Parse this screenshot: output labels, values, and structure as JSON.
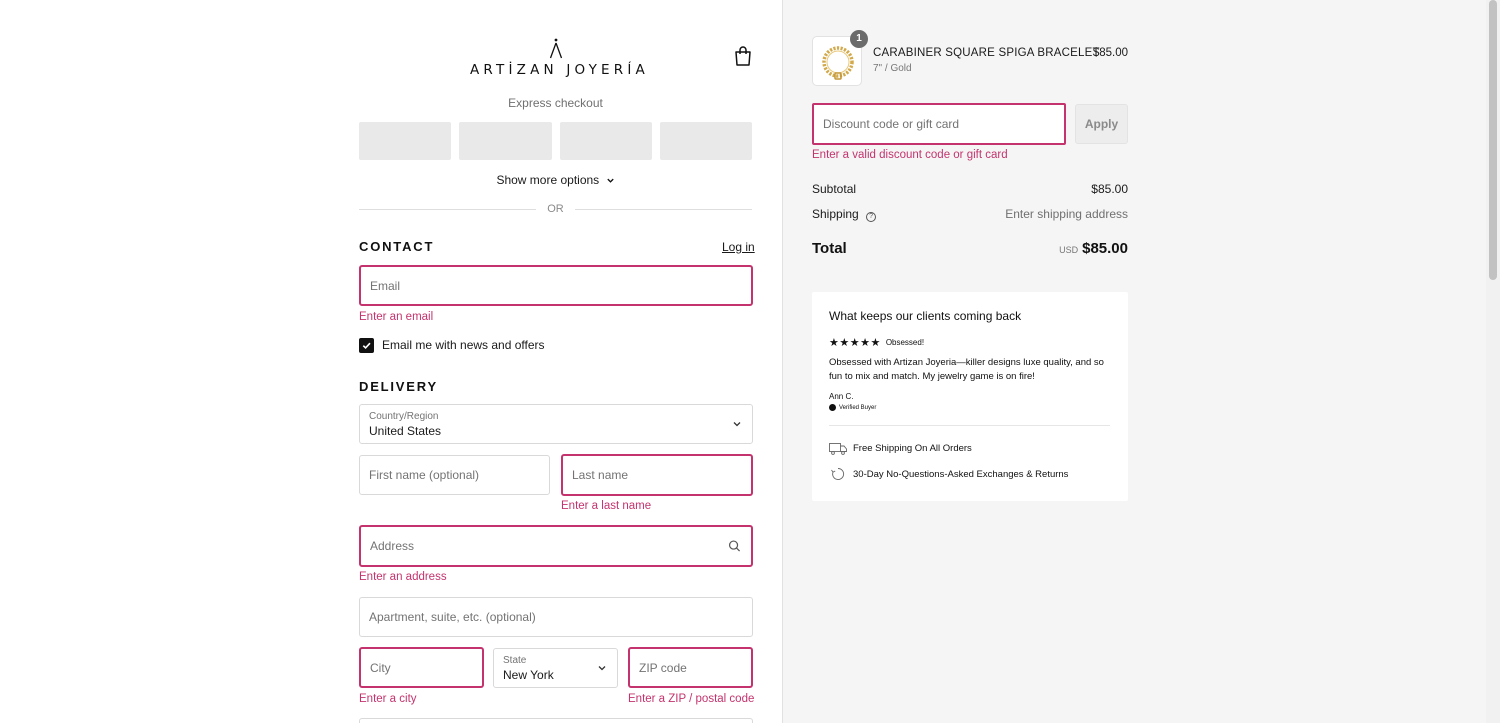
{
  "brand": {
    "name": "ARTİZAN JOYERÍA"
  },
  "express": {
    "title": "Express checkout",
    "buttons": [
      "",
      "",
      "",
      ""
    ],
    "more_options": "Show more options",
    "or": "OR"
  },
  "contact": {
    "title": "CONTACT",
    "login": "Log in",
    "email_placeholder": "Email",
    "email_error": "Enter an email",
    "newsletter_label": "Email me with news and offers",
    "newsletter_checked": true
  },
  "delivery": {
    "title": "DELIVERY",
    "country_label": "Country/Region",
    "country_value": "United States",
    "first_name_placeholder": "First name (optional)",
    "last_name_placeholder": "Last name",
    "last_name_error": "Enter a last name",
    "address_placeholder": "Address",
    "address_error": "Enter an address",
    "apartment_placeholder": "Apartment, suite, etc. (optional)",
    "city_placeholder": "City",
    "city_error": "Enter a city",
    "state_label": "State",
    "state_value": "New York",
    "zip_placeholder": "ZIP code",
    "zip_error": "Enter a ZIP / postal code"
  },
  "order": {
    "item": {
      "quantity": "1",
      "name": "CARABINER SQUARE SPIGA BRACELET",
      "variant": "7\" / Gold",
      "price": "$85.00"
    },
    "discount_placeholder": "Discount code or gift card",
    "apply_label": "Apply",
    "discount_error": "Enter a valid discount code or gift card",
    "subtotal_label": "Subtotal",
    "subtotal_value": "$85.00",
    "shipping_label": "Shipping",
    "shipping_value": "Enter shipping address",
    "total_label": "Total",
    "total_currency": "USD",
    "total_value": "$85.00"
  },
  "review": {
    "title": "What keeps our clients coming back",
    "stars": "★★★★★",
    "rating": 5,
    "stars_label": "Obsessed!",
    "body": "Obsessed with Artizan Joyeria—killer designs luxe quality, and so fun to mix and match. My jewelry game is on fire!",
    "author": "Ann C.",
    "verified": "Verified Buyer",
    "perks": [
      {
        "icon": "truck-icon",
        "text": "Free Shipping On All Orders"
      },
      {
        "icon": "returns-icon",
        "text": "30-Day No-Questions-Asked Exchanges & Returns"
      }
    ]
  },
  "colors": {
    "error": "#c4336e",
    "panel_bg": "#f5f5f5"
  }
}
